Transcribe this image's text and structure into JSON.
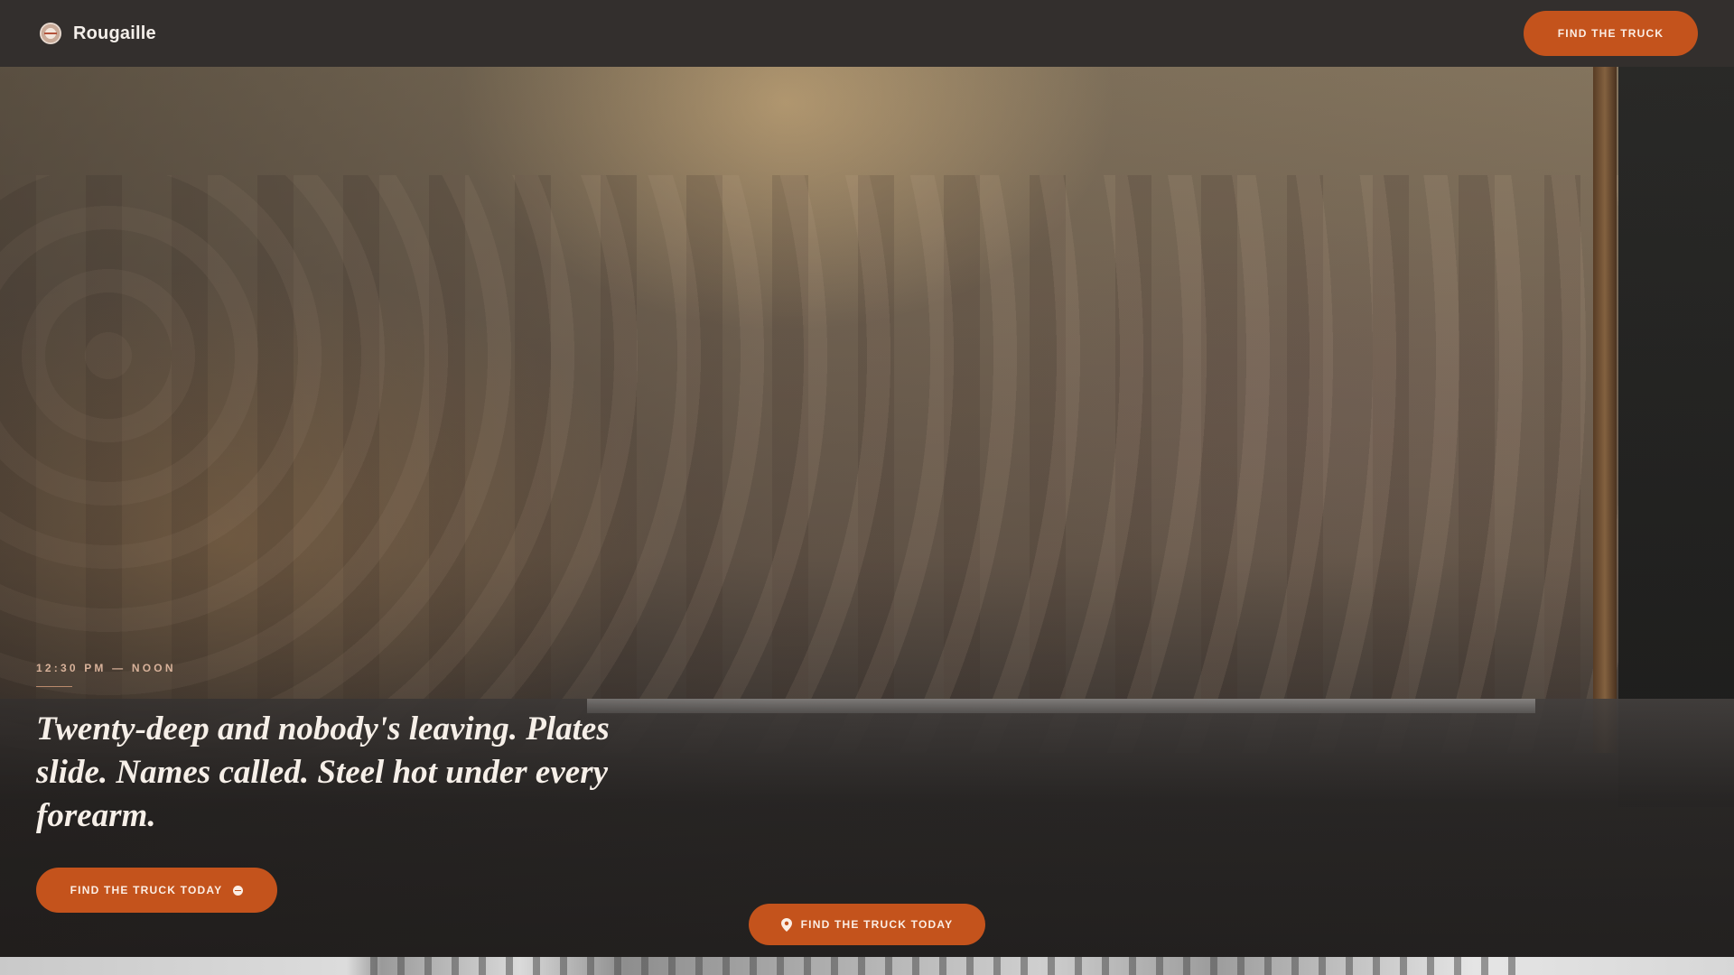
{
  "brand": {
    "name": "Rougaille",
    "logo_icon": "plate-icon"
  },
  "nav": {
    "cta_label": "FIND THE TRUCK"
  },
  "hero": {
    "eyebrow": "12:30 PM — NOON",
    "headline": "Twenty-deep and nobody's leaving. Plates slide. Names called. Steel hot under every forearm.",
    "primary_cta_label": "FIND THE TRUCK TODAY",
    "primary_cta_icon": "dot-icon",
    "floating_cta_label": "FIND THE TRUCK TODAY",
    "floating_cta_icon": "map-pin-icon"
  },
  "colors": {
    "accent": "#c4531c",
    "topbar": "#34302e",
    "text_light": "#f6efe8",
    "eyebrow": "#d8b29a"
  }
}
